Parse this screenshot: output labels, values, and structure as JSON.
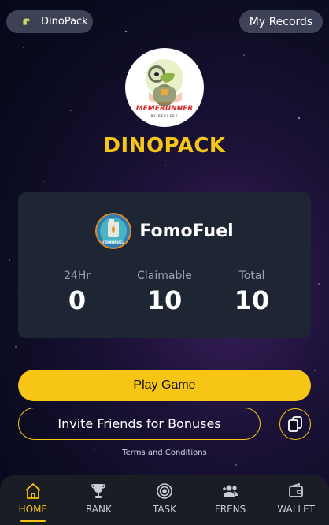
{
  "header": {
    "app_name": "DinoPack",
    "records_label": "My Records"
  },
  "brand": {
    "logo_text": "MEMERUNNER",
    "logo_subtext": "BY BERSERK",
    "title": "DINOPACK",
    "accent_color": "#f5c518"
  },
  "token": {
    "name": "FomoFuel",
    "icon_text": "FOMOFUEL",
    "stats": [
      {
        "label": "24Hr",
        "value": "0"
      },
      {
        "label": "Claimable",
        "value": "10"
      },
      {
        "label": "Total",
        "value": "10"
      }
    ]
  },
  "actions": {
    "play_label": "Play Game",
    "invite_label": "Invite Friends for Bonuses",
    "copy_icon": "copy-icon",
    "terms_label": "Terms and Conditions"
  },
  "nav": {
    "items": [
      {
        "label": "HOME",
        "icon": "home-icon",
        "active": true
      },
      {
        "label": "RANK",
        "icon": "trophy-icon",
        "active": false
      },
      {
        "label": "TASK",
        "icon": "target-icon",
        "active": false
      },
      {
        "label": "FRENS",
        "icon": "add-friends-icon",
        "active": false
      },
      {
        "label": "WALLET",
        "icon": "wallet-icon",
        "active": false
      }
    ]
  }
}
